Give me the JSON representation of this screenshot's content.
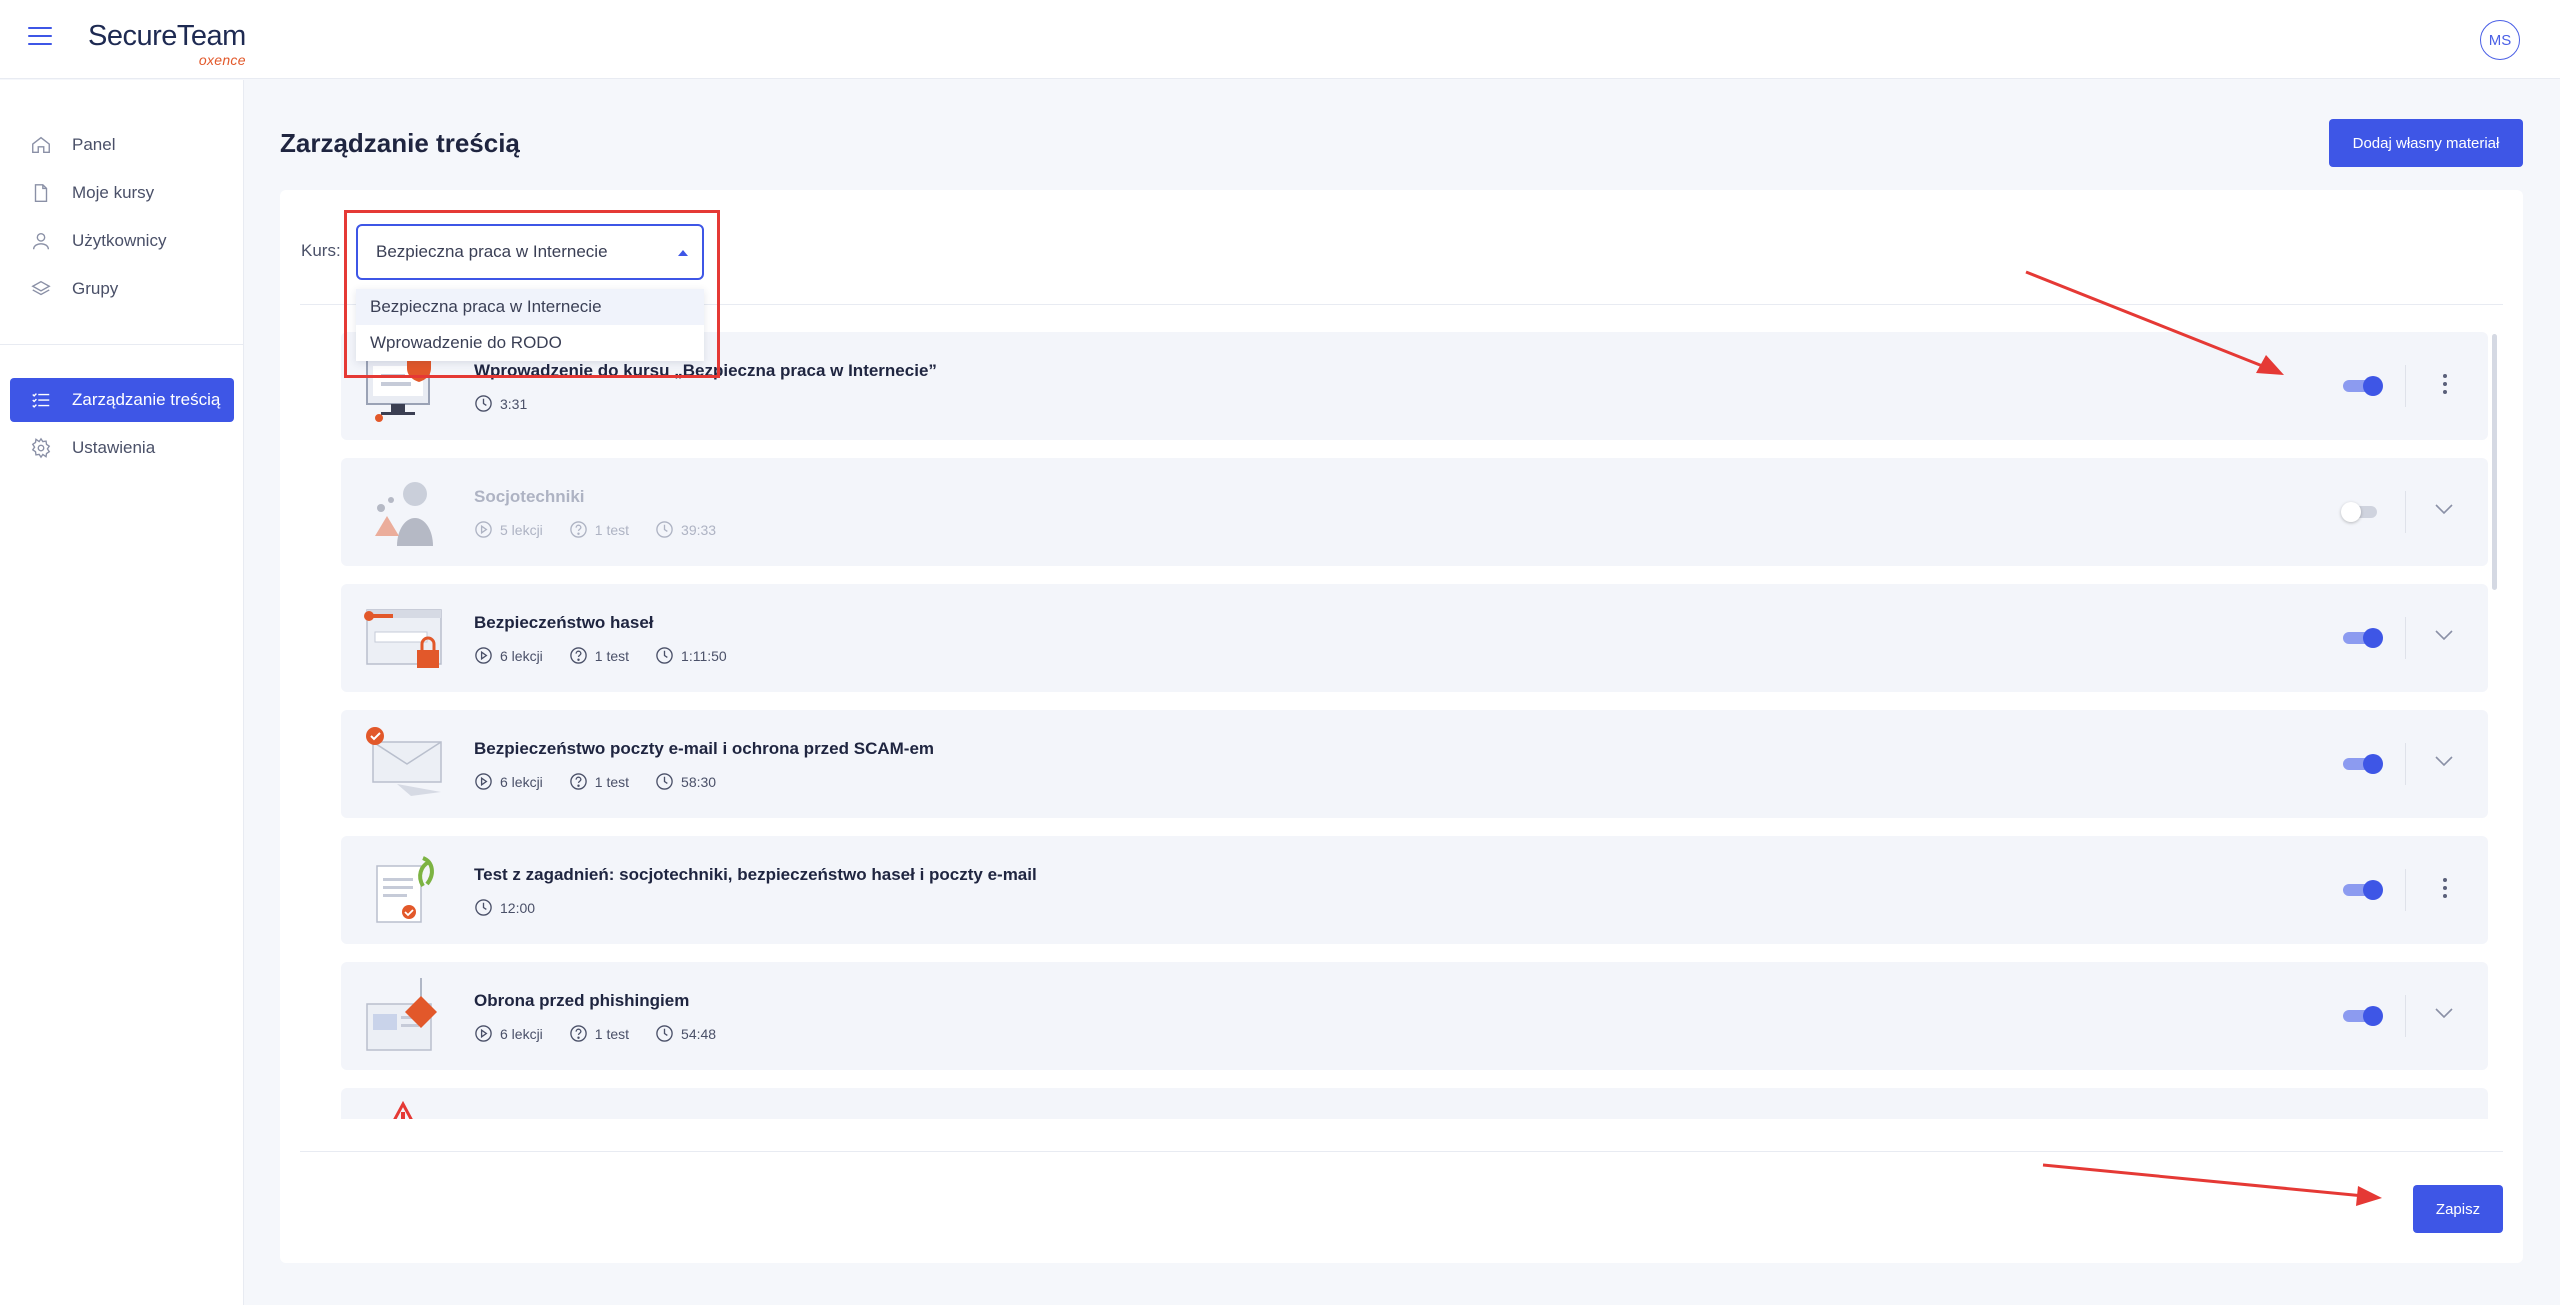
{
  "header": {
    "logo_main": "SecureTeam",
    "logo_sub": "oxence",
    "avatar_initials": "MS"
  },
  "sidebar": {
    "items": [
      {
        "label": "Panel",
        "icon": "home-icon"
      },
      {
        "label": "Moje kursy",
        "icon": "document-icon"
      },
      {
        "label": "Użytkownicy",
        "icon": "user-icon"
      },
      {
        "label": "Grupy",
        "icon": "layers-icon"
      },
      {
        "label": "Zarządzanie treścią",
        "icon": "list-icon",
        "active": true
      },
      {
        "label": "Ustawienia",
        "icon": "gear-icon"
      }
    ]
  },
  "main": {
    "title": "Zarządzanie treścią",
    "add_button": "Dodaj własny materiał",
    "course_label": "Kurs:",
    "course_selected": "Bezpieczna praca w Internecie",
    "course_options": [
      "Bezpieczna praca w Internecie",
      "Wprowadzenie do RODO"
    ],
    "save_button": "Zapisz"
  },
  "modules": [
    {
      "title": "Wprowadzenie do kursu „Bezpieczna praca w Internecie”",
      "duration": "3:31",
      "enabled": true,
      "action": "menu"
    },
    {
      "title": "Socjotechniki",
      "lessons": "5 lekcji",
      "test": "1 test",
      "duration": "39:33",
      "enabled": false,
      "action": "expand"
    },
    {
      "title": "Bezpieczeństwo haseł",
      "lessons": "6 lekcji",
      "test": "1 test",
      "duration": "1:11:50",
      "enabled": true,
      "action": "expand"
    },
    {
      "title": "Bezpieczeństwo poczty e-mail i ochrona przed SCAM-em",
      "lessons": "6 lekcji",
      "test": "1 test",
      "duration": "58:30",
      "enabled": true,
      "action": "expand"
    },
    {
      "title": "Test z zagadnień: socjotechniki, bezpieczeństwo haseł i poczty e-mail",
      "duration": "12:00",
      "enabled": true,
      "action": "menu"
    },
    {
      "title": "Obrona przed phishingiem",
      "lessons": "6 lekcji",
      "test": "1 test",
      "duration": "54:48",
      "enabled": true,
      "action": "expand"
    }
  ],
  "colors": {
    "accent": "#3e56e6",
    "annotation": "#e53935"
  }
}
